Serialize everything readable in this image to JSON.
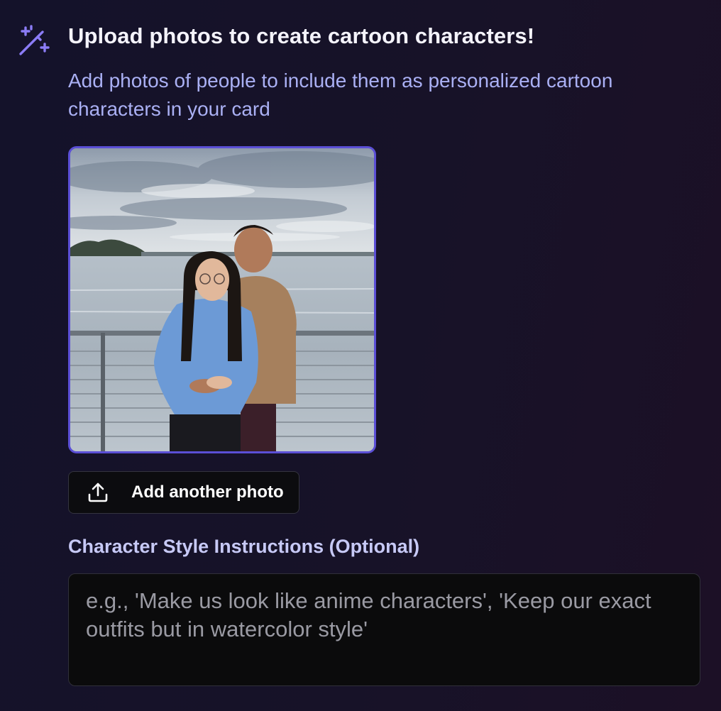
{
  "header": {
    "title": "Upload photos to create cartoon characters!",
    "subtitle": "Add photos of people to include them as personalized cartoon characters in your card",
    "icon": "magic-wand-sparkles-icon"
  },
  "photos": [
    {
      "description_icon": "uploaded-photo"
    }
  ],
  "add_photo_button": {
    "label": "Add another photo",
    "icon": "upload-icon"
  },
  "style_instructions": {
    "label": "Character Style Instructions (Optional)",
    "value": "",
    "placeholder": "e.g., 'Make us look like anime characters', 'Keep our exact outfits but in watercolor style'"
  },
  "colors": {
    "accent": "#8b7cf6",
    "photo_border": "#5b4fd6",
    "subtitle": "#aab0f4",
    "label": "#c7c9f6"
  }
}
